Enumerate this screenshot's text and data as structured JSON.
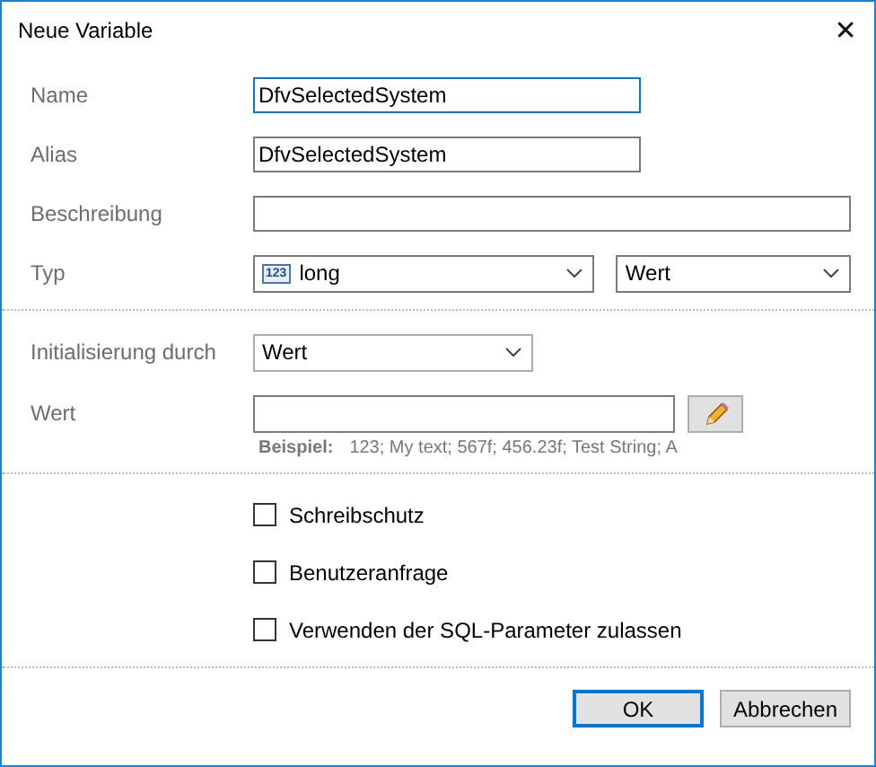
{
  "window": {
    "title": "Neue Variable",
    "close": "✕"
  },
  "fields": [
    {
      "label": "Name",
      "value": "DfvSelectedSystem",
      "focused": true,
      "kind": "short"
    },
    {
      "label": "Alias",
      "value": "DfvSelectedSystem",
      "focused": false,
      "kind": "short"
    },
    {
      "label": "Beschreibung",
      "focused": false,
      "kind": "wide"
    }
  ],
  "type_row": {
    "label": "Typ",
    "type_badge": "123",
    "type_value": "long",
    "mode_value": "Wert"
  },
  "init_row": {
    "label": "Initialisierung durch",
    "value": "Wert"
  },
  "value_row": {
    "label": "Wert",
    "example_label": "Beispiel:",
    "example_text": "123; My text; 567f; 456.23f; Test String; A"
  },
  "checkboxes": [
    {
      "label": "Schreibschutz",
      "checked": false
    },
    {
      "label": "Benutzeranfrage",
      "checked": false
    },
    {
      "label": "Verwenden der SQL-Parameter zulassen",
      "checked": false
    }
  ],
  "buttons": [
    {
      "label": "OK",
      "default": true
    },
    {
      "label": "Abbrechen",
      "default": false
    }
  ]
}
